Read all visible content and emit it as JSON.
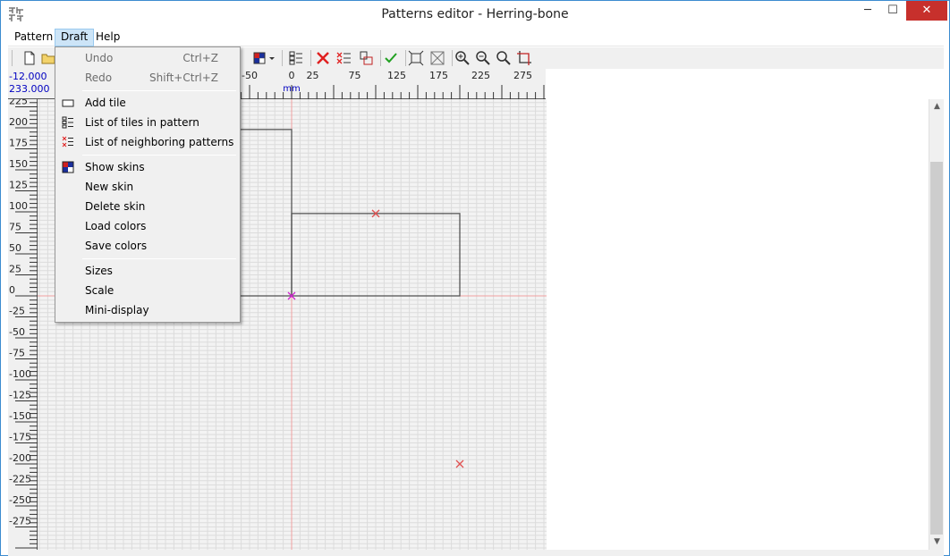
{
  "window": {
    "title": "Patterns editor - Herring-bone",
    "minimize_glyph": "─",
    "maximize_glyph": "☐",
    "close_glyph": "✕"
  },
  "menubar": {
    "items": [
      "Pattern",
      "Draft",
      "Help"
    ]
  },
  "toolbar": {
    "buttons": [
      "new-file-icon",
      "open-folder-icon",
      "skin-color-dropdown-icon",
      "list-icon",
      "delete-red-x-icon",
      "delete-list-icon",
      "tile-split-icon",
      "validate-check-icon",
      "fit-frame-icon",
      "fit-all-icon",
      "zoom-in-icon",
      "zoom-out-icon",
      "zoom-icon",
      "crop-icon"
    ]
  },
  "coords": {
    "x": "-12.000",
    "y": "233.000"
  },
  "ruler_top": {
    "labels": [
      "-50",
      "0",
      "25",
      "75",
      "125",
      "175",
      "225",
      "275"
    ],
    "unit": "mm"
  },
  "ruler_left": {
    "labels": [
      "225",
      "200",
      "175",
      "150",
      "125",
      "100",
      "75",
      "50",
      "25",
      "0",
      "-25",
      "-50",
      "-75",
      "-100",
      "-125",
      "-150",
      "-175",
      "-200",
      "-225",
      "-250",
      "-275"
    ]
  },
  "draft_menu": {
    "items": [
      {
        "label": "Undo",
        "shortcut": "Ctrl+Z",
        "disabled": true,
        "icon": ""
      },
      {
        "label": "Redo",
        "shortcut": "Shift+Ctrl+Z",
        "disabled": true,
        "icon": ""
      },
      {
        "label": "Add tile",
        "shortcut": "",
        "disabled": false,
        "icon": "rectangle-icon"
      },
      {
        "label": "List of tiles in pattern",
        "shortcut": "",
        "disabled": false,
        "icon": "tile-list-icon"
      },
      {
        "label": "List of neighboring patterns",
        "shortcut": "",
        "disabled": false,
        "icon": "neighbor-list-icon"
      },
      {
        "label": "Show skins",
        "shortcut": "",
        "disabled": false,
        "icon": "skins-icon"
      },
      {
        "label": "New skin",
        "shortcut": "",
        "disabled": false,
        "icon": ""
      },
      {
        "label": "Delete skin",
        "shortcut": "",
        "disabled": false,
        "icon": ""
      },
      {
        "label": "Load colors",
        "shortcut": "",
        "disabled": false,
        "icon": ""
      },
      {
        "label": "Save colors",
        "shortcut": "",
        "disabled": false,
        "icon": ""
      },
      {
        "label": "Sizes",
        "shortcut": "",
        "disabled": false,
        "icon": ""
      },
      {
        "label": "Scale",
        "shortcut": "",
        "disabled": false,
        "icon": ""
      },
      {
        "label": "Mini-display",
        "shortcut": "",
        "disabled": false,
        "icon": ""
      }
    ]
  },
  "colors": {
    "accent": "#3c8cd0",
    "close_button": "#c7302c",
    "axis_line": "#f0a0a0",
    "marker_red": "#e05050",
    "origin_marker": "#d020d0",
    "menu_highlight": "#cce4f7"
  }
}
